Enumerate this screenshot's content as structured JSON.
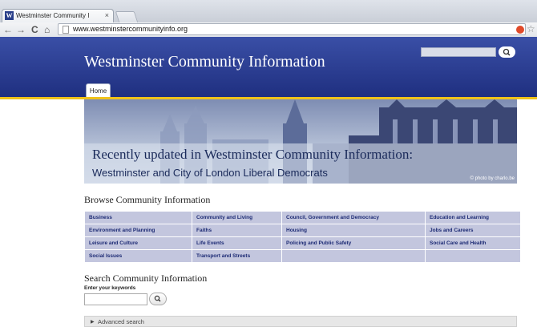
{
  "browser": {
    "tab_title": "Westminster Community I",
    "tab_close": "×",
    "url": "www.westminstercommunityinfo.org",
    "back": "←",
    "forward": "→",
    "reload": "C",
    "home": "⌂",
    "star": "☆"
  },
  "site": {
    "title": "Westminster Community Information",
    "home_tab": "Home",
    "search_icon": "🔍"
  },
  "banner": {
    "title": "Recently updated in Westminster Community Information:",
    "subtitle": "Westminster and City of London Liberal Democrats",
    "credit": "© photo by charlo.be"
  },
  "browse": {
    "heading": "Browse Community Information",
    "rows": [
      [
        "Business",
        "Community and Living",
        "Council, Government and Democracy",
        "Education and Learning"
      ],
      [
        "Environment and Planning",
        "Faiths",
        "Housing",
        "Jobs and Careers"
      ],
      [
        "Leisure and Culture",
        "Life Events",
        "Policing and Public Safety",
        "Social Care and Health"
      ],
      [
        "Social Issues",
        "Transport and Streets",
        "",
        ""
      ]
    ]
  },
  "search": {
    "heading": "Search Community Information",
    "label": "Enter your keywords",
    "value": "",
    "button_icon": "🔍",
    "advanced": "Advanced search"
  },
  "colors": {
    "header": "#2a3c92",
    "stripe": "#f0c21a",
    "cell": "#c3c6de",
    "link": "#1c2a74"
  }
}
